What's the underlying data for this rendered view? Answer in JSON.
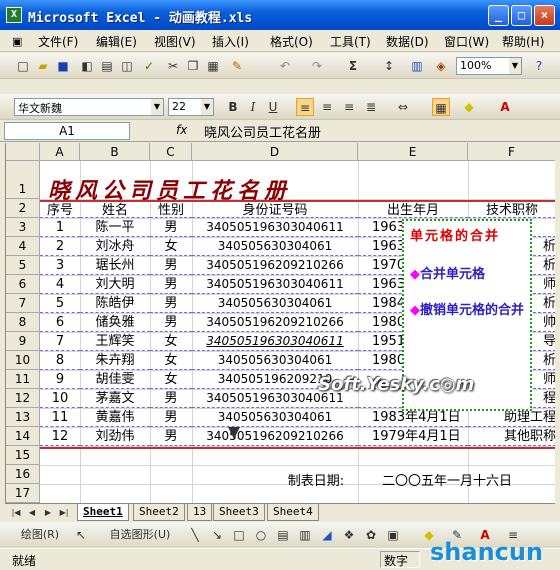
{
  "window": {
    "title": "Microsoft Excel - 动画教程.xls",
    "minimize": "_",
    "maximize": "□",
    "close": "×"
  },
  "menu": [
    "文件(F)",
    "编辑(E)",
    "视图(V)",
    "插入(I)",
    "格式(O)",
    "工具(T)",
    "数据(D)",
    "窗口(W)",
    "帮助(H)"
  ],
  "toolbar": {
    "zoom": "100%"
  },
  "format_toolbar": {
    "font": "华文新魏",
    "size": "22",
    "bold": "B",
    "italic": "I",
    "underline": "U"
  },
  "formula_bar": {
    "name_box": "A1",
    "fx": "fx",
    "value": "晓风公司员工花名册"
  },
  "columns": [
    "A",
    "B",
    "C",
    "D",
    "E",
    "F"
  ],
  "rows": [
    "1",
    "2",
    "3",
    "4",
    "5",
    "6",
    "7",
    "8",
    "9",
    "10",
    "11",
    "12",
    "13",
    "14",
    "15",
    "16",
    "17"
  ],
  "sheet_title": "晓风公司员工花名册",
  "headers": [
    "序号",
    "姓名",
    "性别",
    "身份证号码",
    "出生年月",
    "技术职称"
  ],
  "table": [
    [
      "1",
      "陈一平",
      "男",
      "340505196303040611",
      "1963"
    ],
    [
      "2",
      "刘冰舟",
      "女",
      "340505630304061",
      "1963"
    ],
    [
      "3",
      "琚长州",
      "男",
      "340505196209210266",
      "1970"
    ],
    [
      "4",
      "刘大明",
      "男",
      "340505196303040611",
      "1963"
    ],
    [
      "5",
      "陈皓伊",
      "男",
      "340505630304061",
      "1984"
    ],
    [
      "6",
      "储奂雅",
      "男",
      "340505196209210266",
      "1980"
    ],
    [
      "7",
      "王辉笑",
      "女",
      "340505196303040611",
      "1951"
    ],
    [
      "8",
      "朱卉翔",
      "女",
      "340505630304061",
      "1980"
    ],
    [
      "9",
      "胡佳雯",
      "女",
      "340505196209210",
      ""
    ],
    [
      "10",
      "茅嘉文",
      "男",
      "340505196303040611",
      ""
    ],
    [
      "11",
      "黄嘉伟",
      "男",
      "340505630304061",
      "1983年4月1日"
    ],
    [
      "12",
      "刘劲伟",
      "男",
      "340505196209210266",
      "1979年4月1日"
    ]
  ],
  "f_column_tail": [
    "",
    "析",
    "析",
    "师",
    "析",
    "帅",
    "导",
    "析",
    "师",
    "程",
    "助理工程",
    "其他职称"
  ],
  "footer_label": "制表日期:",
  "footer_date": "二〇〇五年一月十六日",
  "callout": {
    "heading": "单元格的合并",
    "item1": "合并单元格",
    "item2": "撤销单元格的合并",
    "bullet": "◆"
  },
  "watermark": "Soft.Yesky.c◎m",
  "sheet_tabs": [
    "Sheet1",
    "Sheet2",
    "13",
    "Sheet3",
    "Sheet4"
  ],
  "drawbar": {
    "draw": "绘图(R)",
    "autoshape": "自选图形(U)"
  },
  "status": {
    "ready": "就绪",
    "num": "数字"
  },
  "logo": "shancun"
}
